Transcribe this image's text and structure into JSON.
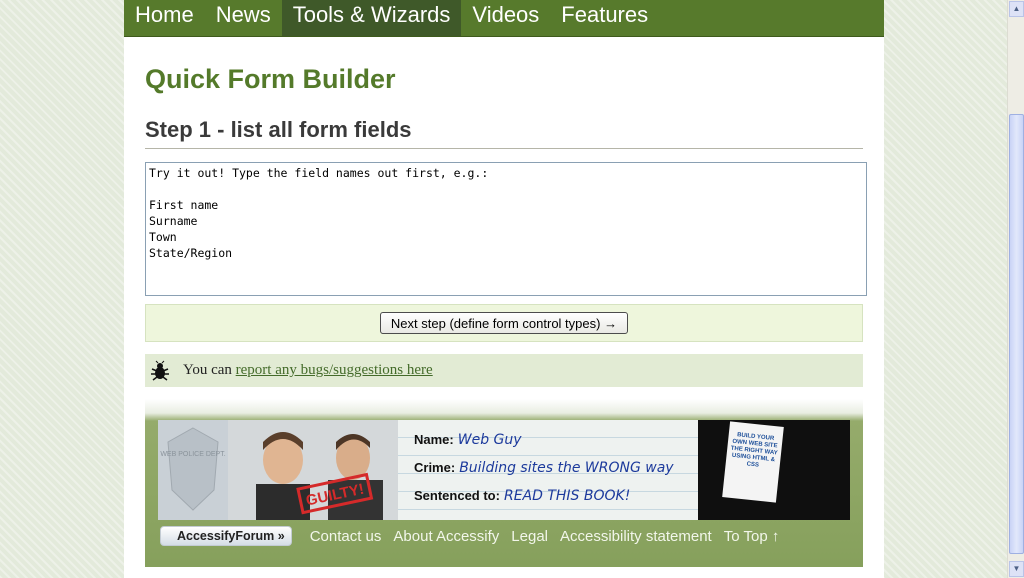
{
  "nav": {
    "items": [
      {
        "label": "Home",
        "active": false
      },
      {
        "label": "News",
        "active": false
      },
      {
        "label": "Tools & Wizards",
        "active": true
      },
      {
        "label": "Videos",
        "active": false
      },
      {
        "label": "Features",
        "active": false
      }
    ]
  },
  "main": {
    "title": "Quick Form Builder",
    "step_heading": "Step 1 - list all form fields",
    "textarea_value": "Try it out! Type the field names out first, e.g.:\n\nFirst name\nSurname\nTown\nState/Region",
    "next_button_label": "Next step (define form control types) →"
  },
  "bug_bar": {
    "icon": "bug-icon",
    "prefix": "You can ",
    "link_text": "report any bugs/suggestions here"
  },
  "banner": {
    "name_label": "Name:",
    "name_value": "Web Guy",
    "crime_label": "Crime:",
    "crime_value": "Building sites the WRONG way",
    "sentence_label": "Sentenced to:",
    "sentence_value": "READ THIS BOOK!",
    "stamp_text": "GUILTY!",
    "badge_text": "WEB POLICE DEPT.",
    "book_text": "BUILD YOUR OWN WEB SITE THE RIGHT WAY USING HTML & CSS"
  },
  "footer": {
    "forum_button": "AccessifyForum »",
    "links": [
      "Contact us",
      "About Accessify",
      "Legal",
      "Accessibility statement",
      "To Top ↑"
    ]
  },
  "colors": {
    "nav_bg": "#577a2c",
    "nav_active_bg": "#3f5929",
    "title": "#547a2a",
    "next_bar_bg": "#eef6dc",
    "bug_bar_bg": "#e2ebd4",
    "footer_bg": "#86a05c"
  }
}
